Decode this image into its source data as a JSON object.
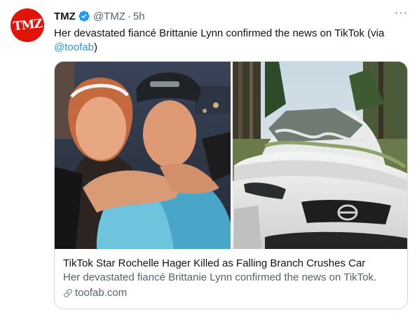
{
  "tweet": {
    "author_name": "TMZ",
    "avatar_text": "TMZ",
    "handle": "@TMZ",
    "separator": "·",
    "time": "5h",
    "more": "···",
    "text": "Her devastated fiancé Brittanie Lynn confirmed the news on TikTok (via ",
    "mention": "@toofab",
    "text_end": ")"
  },
  "card": {
    "title": "TikTok Star Rochelle Hager Killed as Falling Branch Crushes Car",
    "description": "Her devastated fiancé Brittanie Lynn confirmed the news on TikTok.",
    "domain": "toofab.com"
  },
  "colors": {
    "brand_red": "#e1140a",
    "link_blue": "#1d9bf0",
    "secondary_text": "#536471",
    "border": "#cfd9de"
  },
  "icons": {
    "verified": "verified-badge-icon",
    "link": "link-icon"
  }
}
